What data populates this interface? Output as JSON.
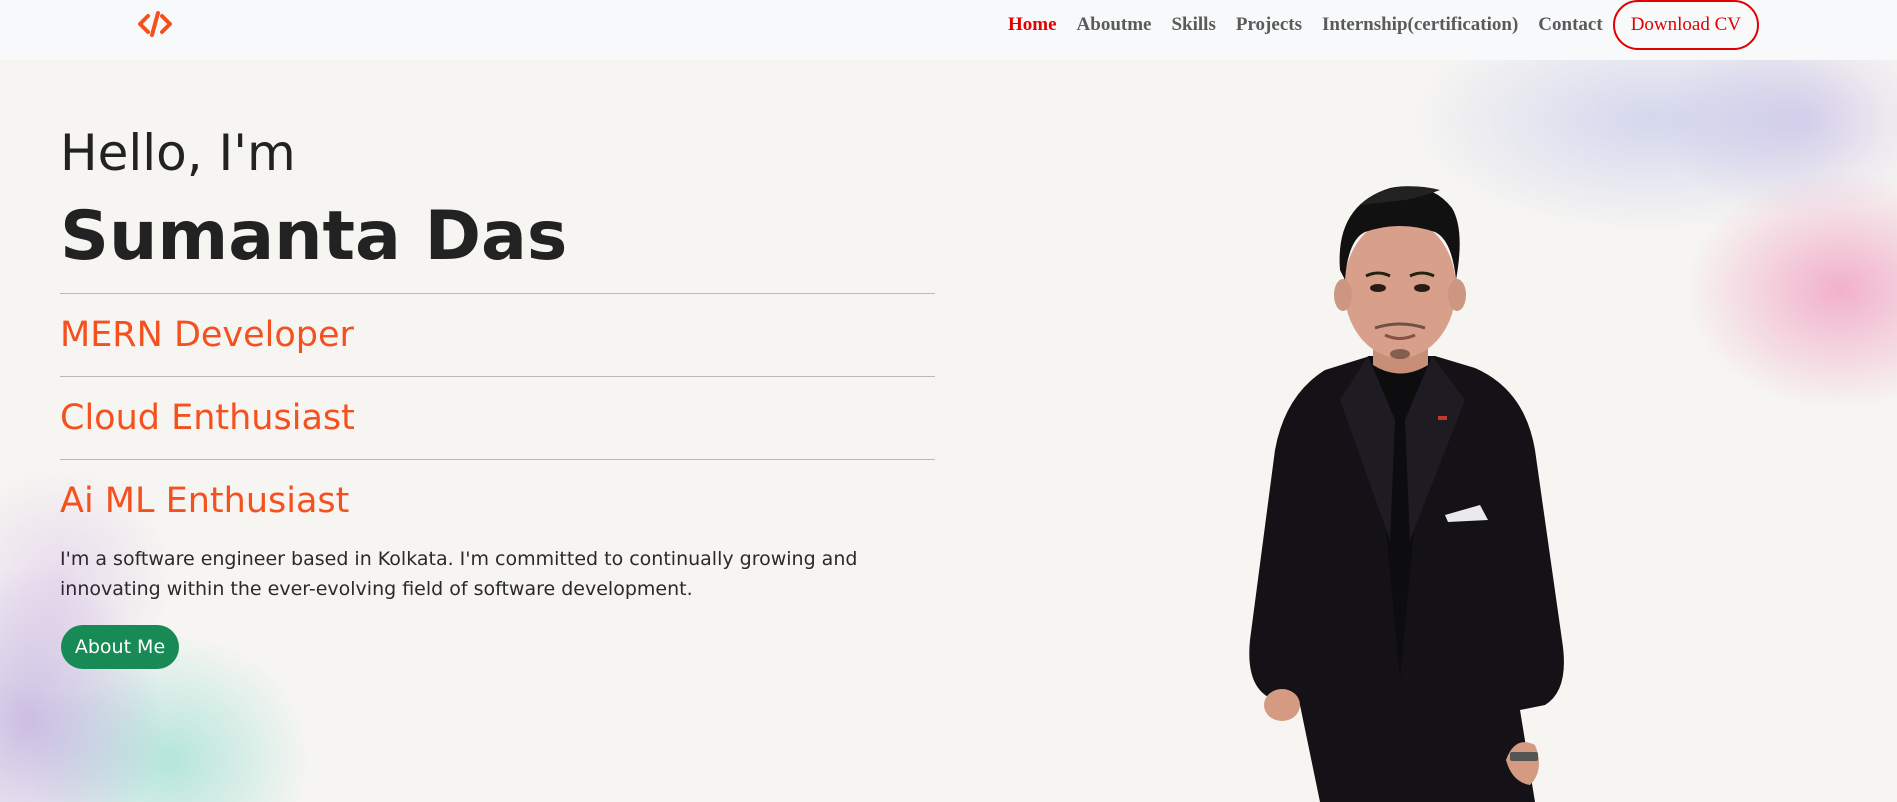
{
  "logo": {
    "icon": "code-brackets-icon",
    "color": "#f4511e"
  },
  "nav": {
    "items": [
      {
        "label": "Home",
        "active": true
      },
      {
        "label": "Aboutme",
        "active": false
      },
      {
        "label": "Skills",
        "active": false
      },
      {
        "label": "Projects",
        "active": false
      },
      {
        "label": "Internship(certification)",
        "active": false
      },
      {
        "label": "Contact",
        "active": false
      }
    ],
    "cv_button": "Download CV",
    "active_color": "#e00000"
  },
  "hero": {
    "greeting": "Hello, I'm",
    "name": "Sumanta Das",
    "roles": [
      "MERN Developer",
      "Cloud Enthusiast",
      "Ai ML Enthusiast"
    ],
    "role_color": "#f4511e",
    "intro": "I'm a software engineer based in Kolkata. I'm committed to continually growing and innovating within the ever-evolving field of software development.",
    "about_button": "About Me",
    "about_button_color": "#188a55"
  },
  "portrait": {
    "subject": "man in black suit"
  }
}
